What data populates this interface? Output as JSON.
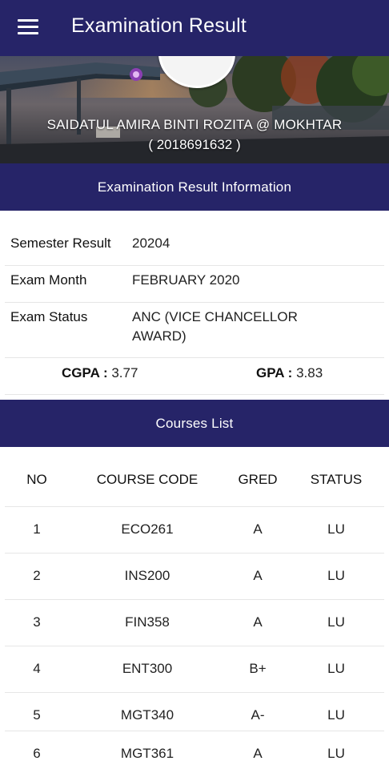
{
  "appbar": {
    "title": "Examination Result"
  },
  "student": {
    "name": "SAIDATUL AMIRA BINTI ROZITA @ MOKHTAR",
    "id": "( 2018691632 )"
  },
  "info_section": {
    "header": "Examination Result Information",
    "semester_label": "Semester Result",
    "semester_value": "20204",
    "month_label": "Exam Month",
    "month_value": "FEBRUARY 2020",
    "status_label": "Exam Status",
    "status_value_line1": "ANC (VICE CHANCELLOR",
    "status_value_line2": "AWARD)",
    "cgpa_label": "CGPA :",
    "cgpa_value": "3.77",
    "gpa_label": "GPA :",
    "gpa_value": "3.83"
  },
  "courses": {
    "header": "Courses List",
    "columns": {
      "no": "NO",
      "code": "COURSE CODE",
      "grade": "GRED",
      "status": "STATUS"
    },
    "rows": [
      {
        "no": "1",
        "code": "ECO261",
        "grade": "A",
        "status": "LU"
      },
      {
        "no": "2",
        "code": "INS200",
        "grade": "A",
        "status": "LU"
      },
      {
        "no": "3",
        "code": "FIN358",
        "grade": "A",
        "status": "LU"
      },
      {
        "no": "4",
        "code": "ENT300",
        "grade": "B+",
        "status": "LU"
      },
      {
        "no": "5",
        "code": "MGT340",
        "grade": "A-",
        "status": "LU"
      },
      {
        "no": "6",
        "code": "MGT361",
        "grade": "A",
        "status": "LU"
      }
    ]
  },
  "colors": {
    "primary": "#262468",
    "text": "#222222",
    "divider": "#e6e6e6"
  },
  "icons": {
    "menu": "hamburger-menu-icon",
    "avatar": "avatar"
  }
}
